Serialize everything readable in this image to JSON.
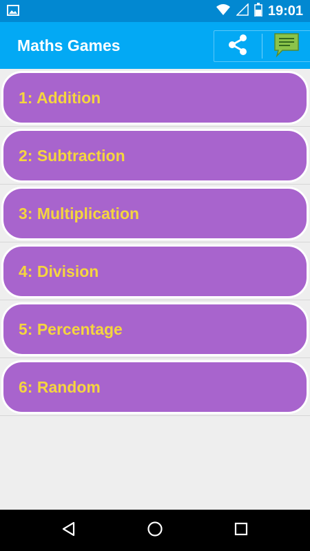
{
  "status_bar": {
    "time": "19:01"
  },
  "app_bar": {
    "title": "Maths Games"
  },
  "menu": {
    "items": [
      {
        "label": "1: Addition"
      },
      {
        "label": "2: Subtraction"
      },
      {
        "label": "3: Multiplication"
      },
      {
        "label": "4: Division"
      },
      {
        "label": "5: Percentage"
      },
      {
        "label": "6: Random"
      }
    ]
  },
  "icons": {
    "status_left": "image-notification-icon",
    "wifi": "wifi-icon",
    "signal": "cellular-signal-icon",
    "battery": "battery-icon",
    "share": "share-icon",
    "comment": "comment-icon",
    "back": "back-icon",
    "home": "home-icon",
    "recent": "recent-apps-icon"
  },
  "colors": {
    "status_bar": "#0288d1",
    "app_bar": "#03a9f4",
    "item_fill": "#a864cd",
    "item_text": "#f5d53f",
    "comment_icon": "#8bc34a",
    "background": "#eeeeee"
  }
}
